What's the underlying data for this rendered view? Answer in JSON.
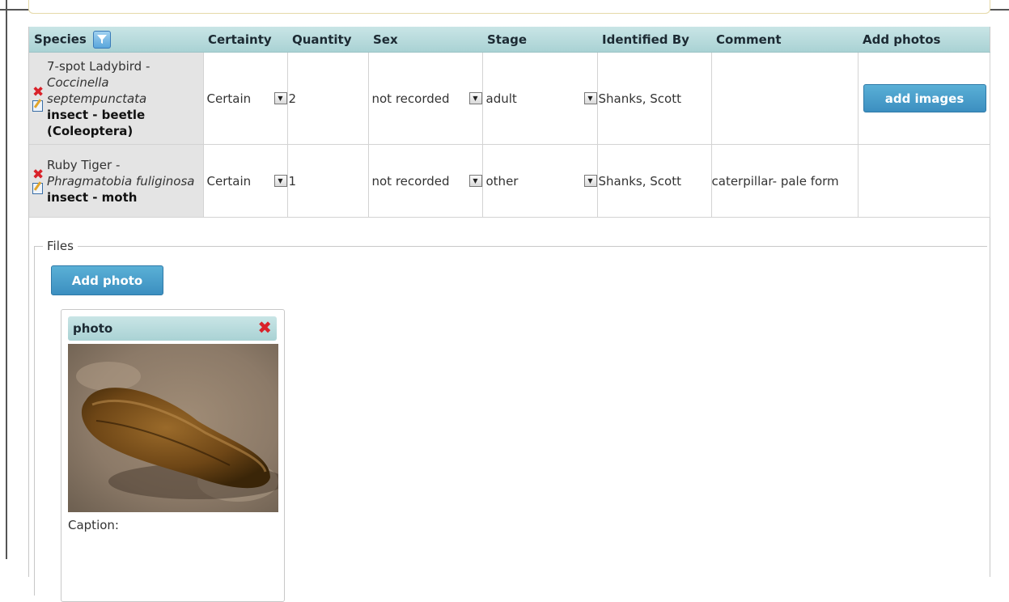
{
  "table": {
    "headers": {
      "species": "Species",
      "certainty": "Certainty",
      "quantity": "Quantity",
      "sex": "Sex",
      "stage": "Stage",
      "identified_by": "Identified By",
      "comment": "Comment",
      "add_photos": "Add photos"
    },
    "filter_icon": "filter-icon",
    "rows": [
      {
        "common": "7-spot Ladybird -",
        "latin": "Coccinella septempunctata",
        "group": "insect - beetle (Coleoptera)",
        "certainty": "Certain",
        "quantity": "2",
        "sex": "not recorded",
        "stage": "adult",
        "identified_by": "Shanks, Scott",
        "comment": "",
        "add_images_label": "add images"
      },
      {
        "common": "Ruby Tiger -",
        "latin": "Phragmatobia fuliginosa",
        "group": "insect - moth",
        "certainty": "Certain",
        "quantity": "1",
        "sex": "not recorded",
        "stage": "other",
        "identified_by": "Shanks, Scott",
        "comment": "caterpillar- pale form",
        "add_images_label": ""
      }
    ]
  },
  "files": {
    "legend": "Files",
    "add_photo_label": "Add photo",
    "photo": {
      "title": "photo",
      "caption_label": "Caption:"
    }
  },
  "colors": {
    "header_teal": "#b3dadb",
    "button_blue": "#4a9fcc",
    "delete_red": "#d9222a",
    "species_cell_grey": "#e4e4e4"
  }
}
